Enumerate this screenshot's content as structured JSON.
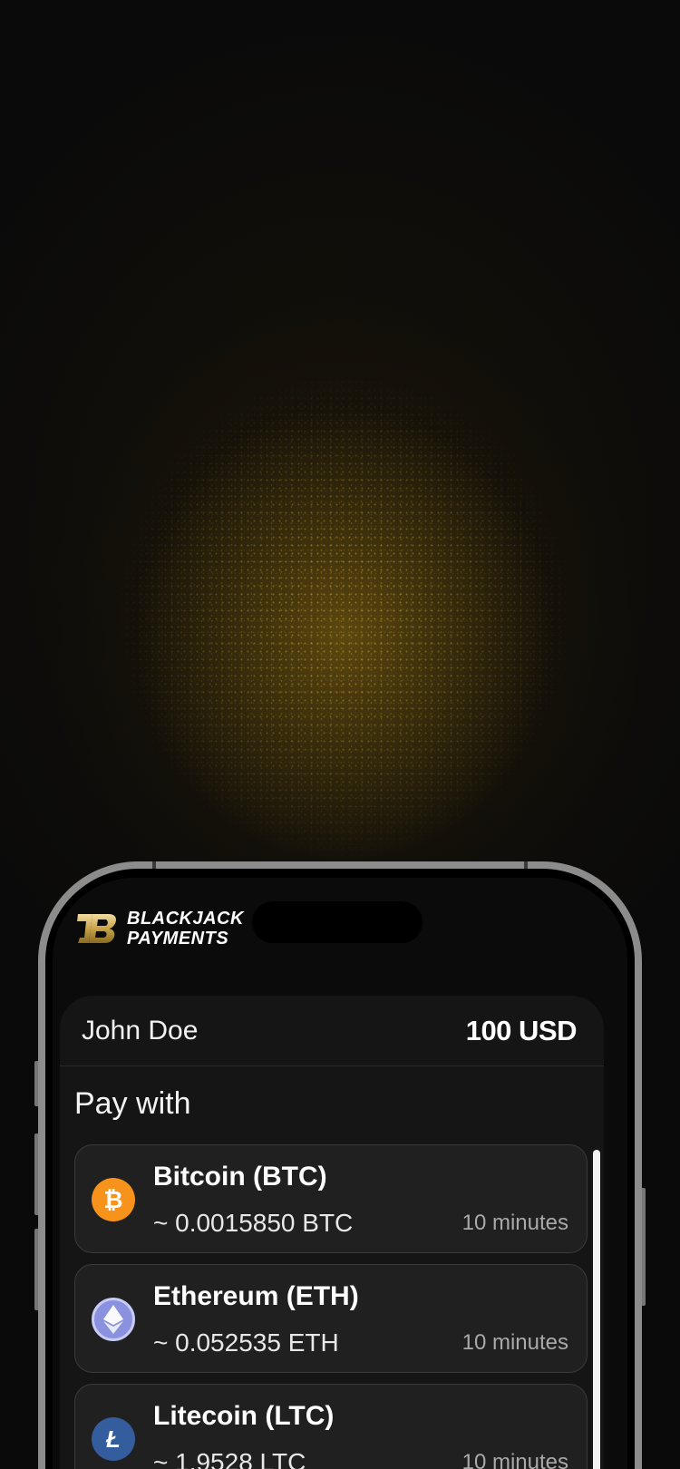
{
  "brand": {
    "line1": "BLACKJACK",
    "line2": "PAYMENTS"
  },
  "header": {
    "user_name": "John Doe",
    "amount": "100 USD"
  },
  "pay_with_label": "Pay with",
  "coins": [
    {
      "name": "Bitcoin (BTC)",
      "amount": "~ 0.0015850 BTC",
      "time": "10 minutes",
      "icon": "bitcoin-icon",
      "color": "#F7931A"
    },
    {
      "name": "Ethereum (ETH)",
      "amount": "~ 0.052535 ETH",
      "time": "10 minutes",
      "icon": "ethereum-icon",
      "color": "#8A92E0"
    },
    {
      "name": "Litecoin (LTC)",
      "amount": "~ 1.9528 LTC",
      "time": "10 minutes",
      "icon": "litecoin-icon",
      "color": "#345D9D"
    }
  ],
  "colors": {
    "gold": "#C9A44A",
    "background": "#0A0A0A",
    "card": "#151515",
    "row": "#202020"
  }
}
